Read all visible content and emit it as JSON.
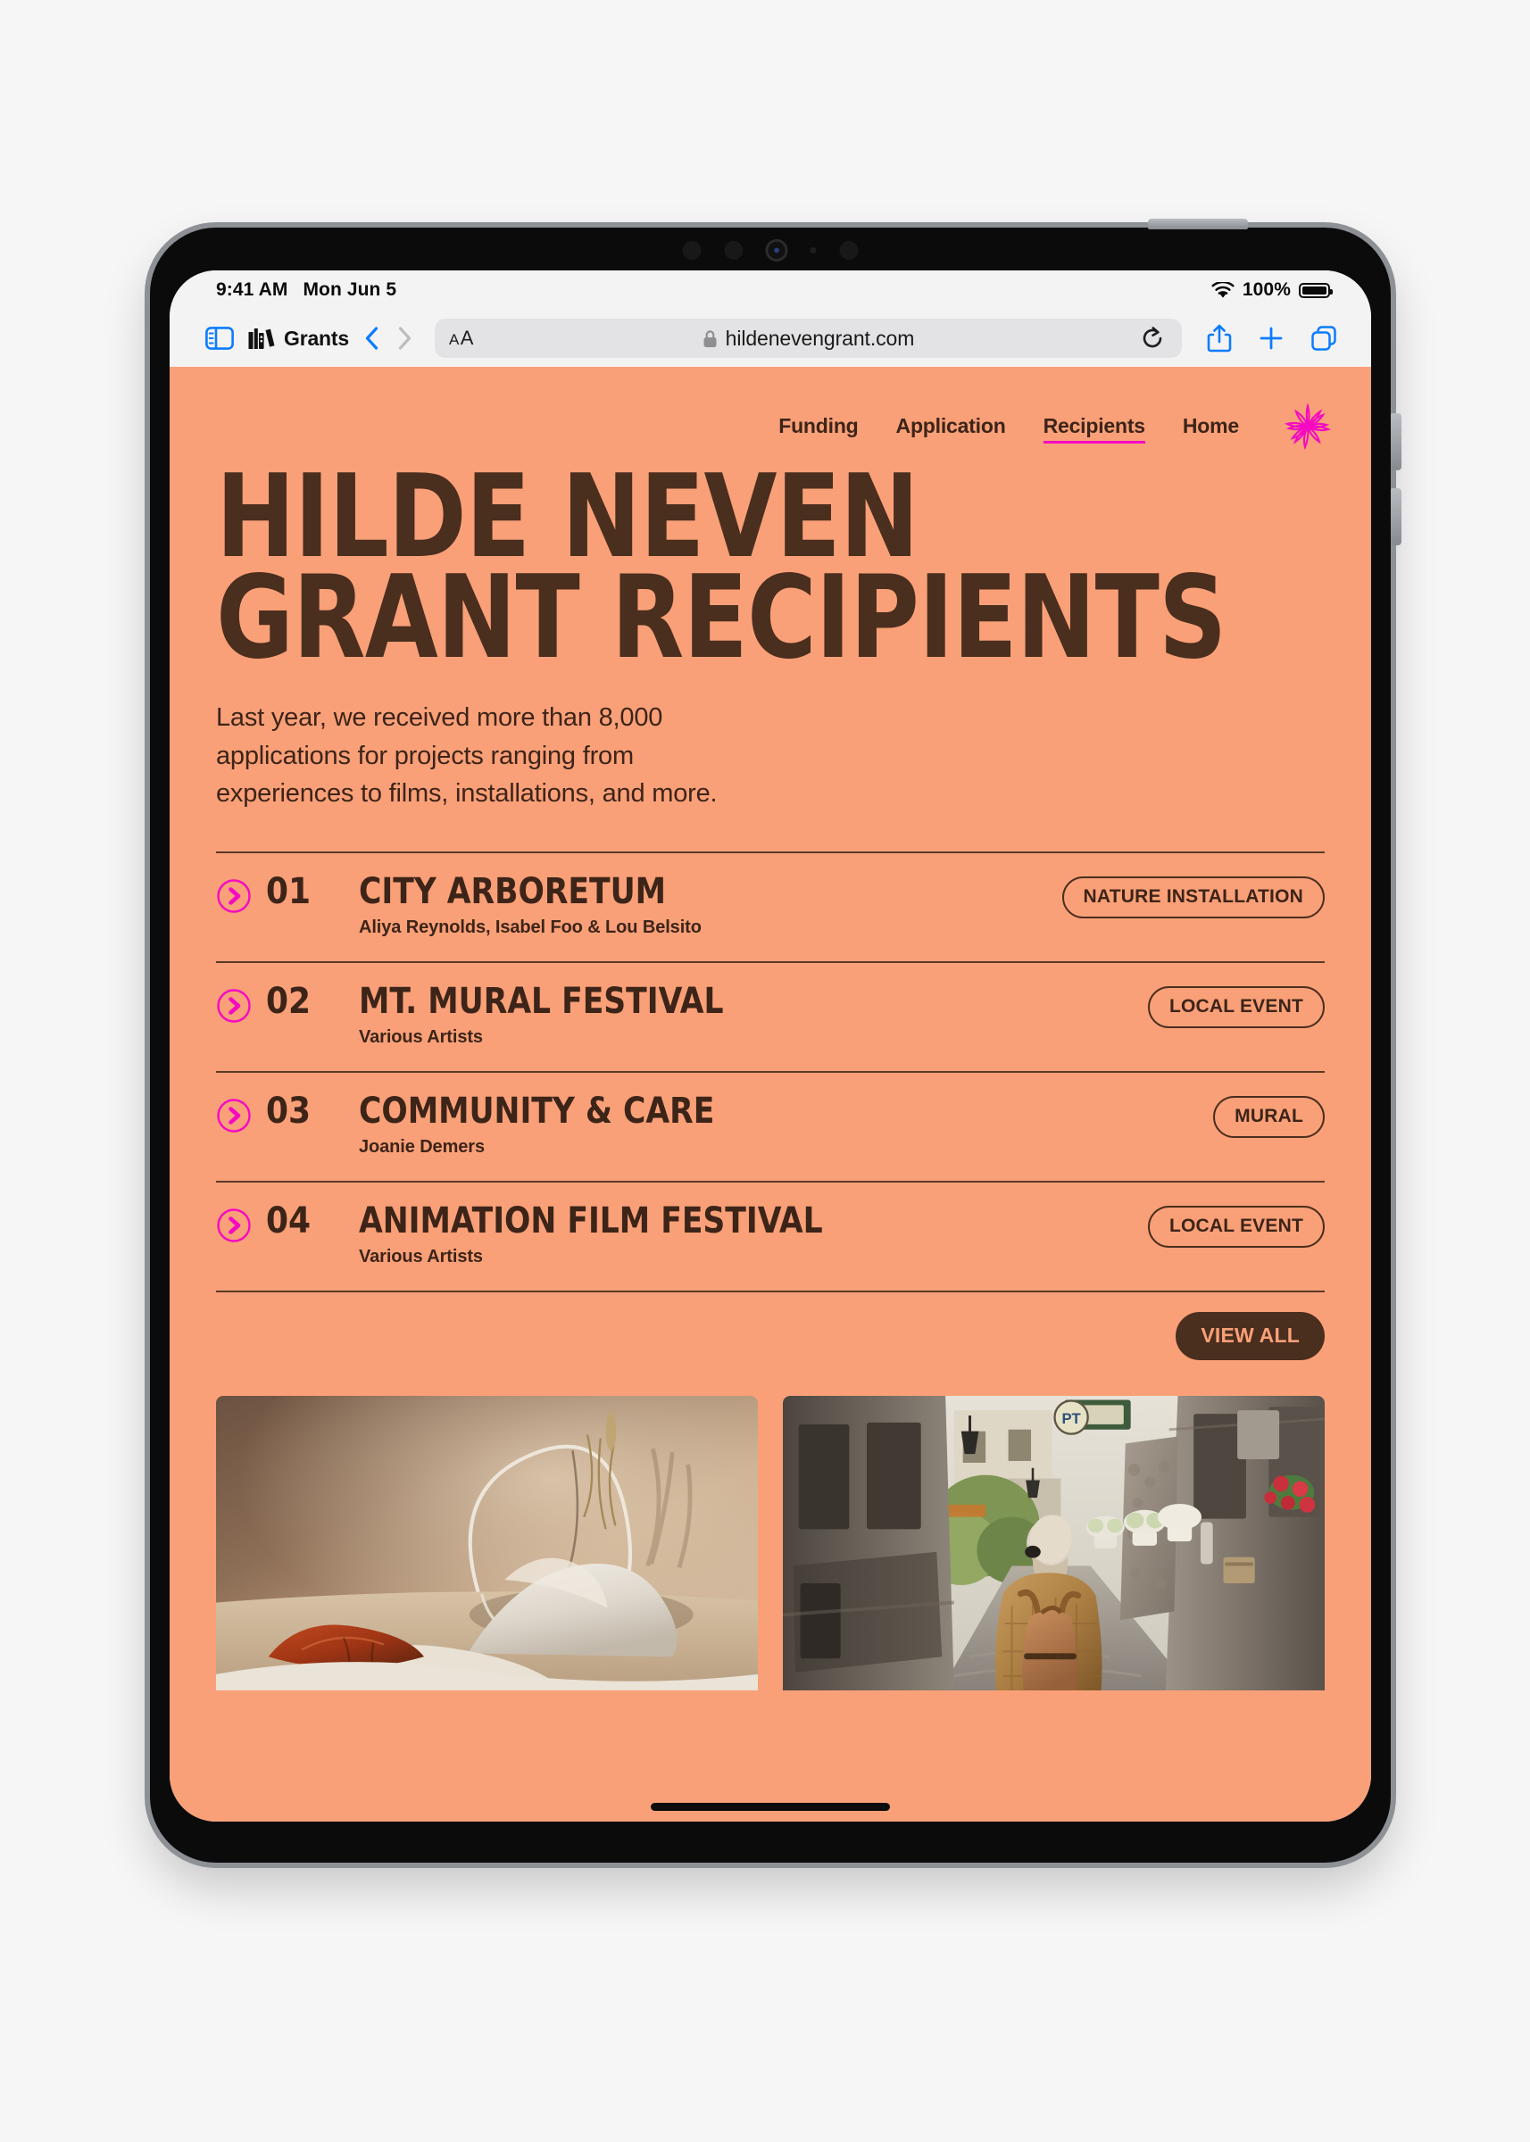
{
  "status_bar": {
    "time": "9:41 AM",
    "date": "Mon Jun 5",
    "battery_percent": "100%",
    "wifi_icon": "wifi-icon",
    "battery_icon": "battery-full-icon"
  },
  "toolbar": {
    "sidebar_icon": "sidebar-icon",
    "bookmark_icon": "books-icon",
    "bookmark_label": "Grants",
    "back_icon": "chevron-left-icon",
    "forward_icon": "chevron-right-icon",
    "text_size_label": "AA",
    "lock_icon": "lock-icon",
    "url": "hildenevengrant.com",
    "reload_icon": "reload-icon",
    "share_icon": "share-icon",
    "new_tab_icon": "plus-icon",
    "tabs_icon": "tabs-icon"
  },
  "colors": {
    "page_background": "#f9a078",
    "ink": "#3d2418",
    "ink_deep": "#4a2e1e",
    "accent_magenta": "#f50ac2",
    "safari_blue": "#0a7cff",
    "toolbar_grey": "#f4f3f3",
    "url_field": "#e3e3e5"
  },
  "site": {
    "nav": [
      {
        "label": "Funding",
        "active": false
      },
      {
        "label": "Application",
        "active": false
      },
      {
        "label": "Recipients",
        "active": true
      },
      {
        "label": "Home",
        "active": false
      }
    ],
    "logo_icon": "flower-starburst-icon",
    "hero": {
      "title_line_1": "HILDE NEVEN",
      "title_line_2": "GRANT RECIPIENTS",
      "intro_line_1": "Last year, we received more than 8,000",
      "intro_line_2": "applications for projects ranging from",
      "intro_line_3": "experiences to films, installations, and more."
    },
    "recipients": [
      {
        "number": "01",
        "title": "CITY ARBORETUM",
        "people": "Aliya Reynolds, Isabel Foo & Lou Belsito",
        "badge": "NATURE INSTALLATION",
        "arrow_icon": "circle-arrow-right-icon"
      },
      {
        "number": "02",
        "title": "MT. MURAL FESTIVAL",
        "people": "Various Artists",
        "badge": "LOCAL EVENT",
        "arrow_icon": "circle-arrow-right-icon"
      },
      {
        "number": "03",
        "title": "COMMUNITY & CARE",
        "people": "Joanie Demers",
        "badge": "MURAL",
        "arrow_icon": "circle-arrow-right-icon"
      },
      {
        "number": "04",
        "title": "ANIMATION FILM FESTIVAL",
        "people": "Various Artists",
        "badge": "LOCAL EVENT",
        "arrow_icon": "circle-arrow-right-icon"
      }
    ],
    "view_all_label": "VIEW ALL",
    "gallery": [
      {
        "name": "still-life-photo",
        "alt": "Terracotta stone and white powder with thin metal ring and dried grass on warm beige backdrop"
      },
      {
        "name": "alley-walk-photo",
        "alt": "Woman with backpack walking down a narrow European stone alley with flower boxes"
      }
    ]
  }
}
